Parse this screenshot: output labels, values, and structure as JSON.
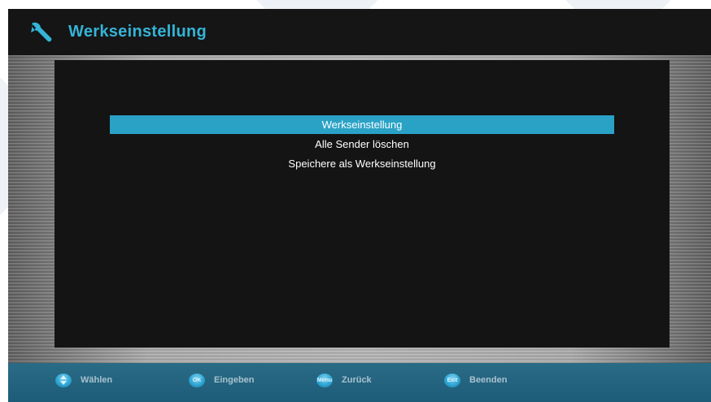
{
  "header": {
    "title": "Werkseinstellung",
    "icon": "wrench-icon",
    "title_color": "#34b4d6"
  },
  "menu": {
    "items": [
      {
        "label": "Werkseinstellung",
        "selected": true
      },
      {
        "label": "Alle Sender löschen",
        "selected": false
      },
      {
        "label": "Speichere als Werkseinstellung",
        "selected": false
      }
    ],
    "highlight_color": "#2aa2c6"
  },
  "footer": {
    "hints": [
      {
        "key": "",
        "label": "Wählen",
        "icon": "up-down-arrows-icon"
      },
      {
        "key": "OK",
        "label": "Eingeben",
        "icon": "ok-button-icon"
      },
      {
        "key": "Menu",
        "label": "Zurück",
        "icon": "menu-button-icon"
      },
      {
        "key": "Exit",
        "label": "Beenden",
        "icon": "exit-button-icon"
      }
    ]
  }
}
